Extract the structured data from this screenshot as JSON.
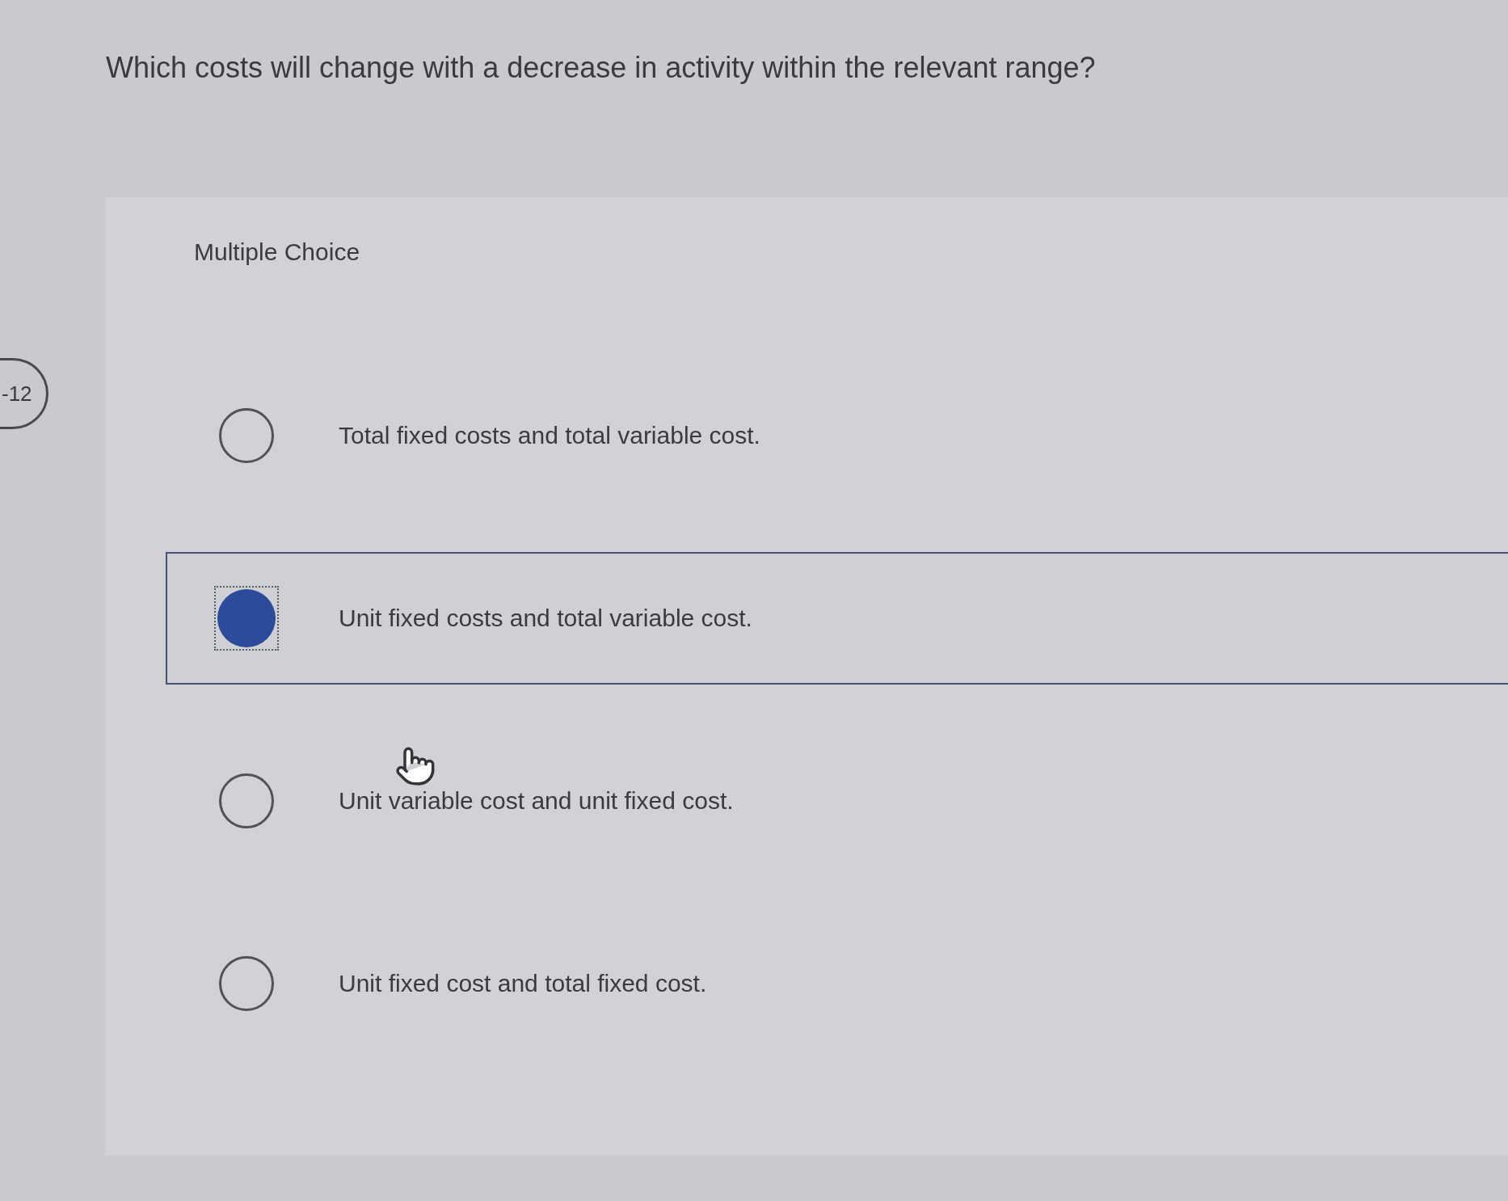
{
  "badge": {
    "text": "-12"
  },
  "question": "Which costs will change with a decrease in activity within the relevant range?",
  "section_label": "Multiple Choice",
  "options": [
    {
      "label": "Total fixed costs and total variable cost.",
      "selected": false
    },
    {
      "label": "Unit fixed costs and total variable cost.",
      "selected": true
    },
    {
      "label": "Unit variable cost and unit fixed cost.",
      "selected": false
    },
    {
      "label": "Unit fixed cost and total fixed cost.",
      "selected": false
    }
  ]
}
